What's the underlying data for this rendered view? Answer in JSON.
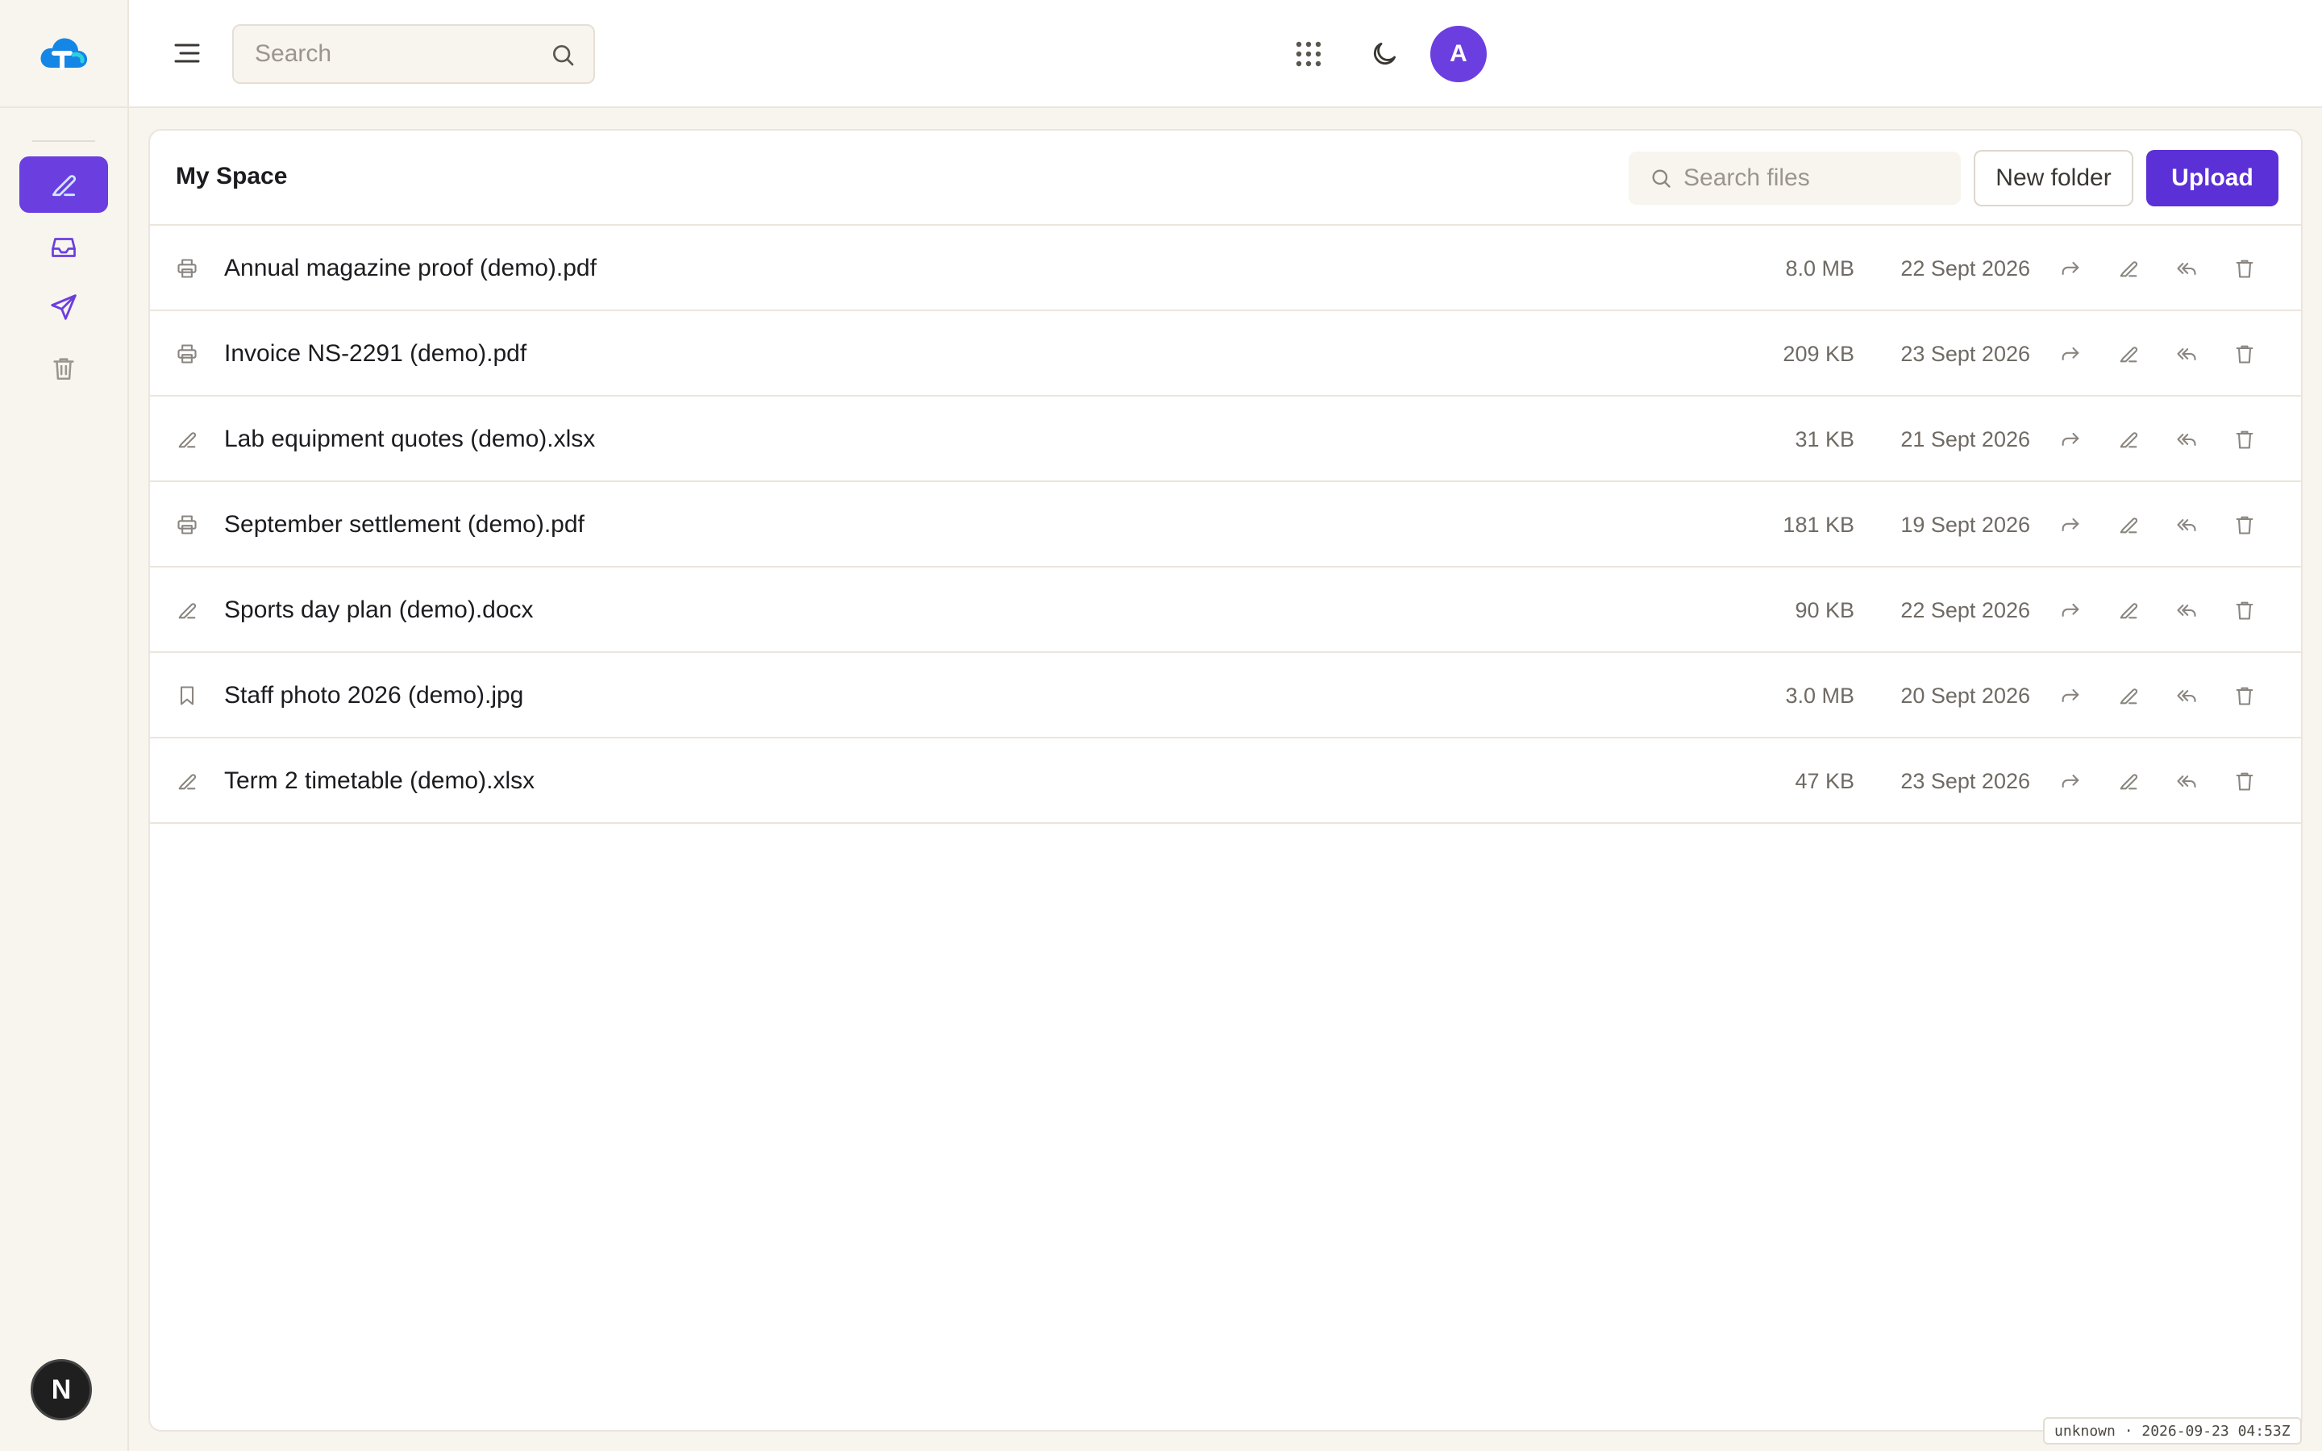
{
  "topbar": {
    "search_placeholder": "Search",
    "avatar_initial": "A"
  },
  "rail": {
    "items": [
      {
        "icon": "pencil-icon",
        "active": true
      },
      {
        "icon": "inbox-icon",
        "active": false
      },
      {
        "icon": "send-icon",
        "active": false
      },
      {
        "icon": "trash-icon",
        "active": false
      }
    ],
    "bottom_avatar": "N"
  },
  "panel": {
    "title": "My Space",
    "search_placeholder": "Search files",
    "new_folder_label": "New folder",
    "upload_label": "Upload"
  },
  "files": [
    {
      "name": "Annual magazine proof (demo).pdf",
      "size": "8.0 MB",
      "date": "22 Sept 2026",
      "icon": "printer-icon"
    },
    {
      "name": "Invoice NS-2291 (demo).pdf",
      "size": "209 KB",
      "date": "23 Sept 2026",
      "icon": "printer-icon"
    },
    {
      "name": "Lab equipment quotes (demo).xlsx",
      "size": "31 KB",
      "date": "21 Sept 2026",
      "icon": "pencil-icon"
    },
    {
      "name": "September settlement (demo).pdf",
      "size": "181 KB",
      "date": "19 Sept 2026",
      "icon": "printer-icon"
    },
    {
      "name": "Sports day plan (demo).docx",
      "size": "90 KB",
      "date": "22 Sept 2026",
      "icon": "pencil-icon"
    },
    {
      "name": "Staff photo 2026 (demo).jpg",
      "size": "3.0 MB",
      "date": "20 Sept 2026",
      "icon": "bookmark-icon"
    },
    {
      "name": "Term 2 timetable (demo).xlsx",
      "size": "47 KB",
      "date": "23 Sept 2026",
      "icon": "pencil-icon"
    }
  ],
  "footer": {
    "stamp": "unknown · 2026-09-23 04:53Z"
  },
  "colors": {
    "accent": "#6b3ee0",
    "primary_button": "#5b30d6",
    "background": "#f8f5ef"
  }
}
